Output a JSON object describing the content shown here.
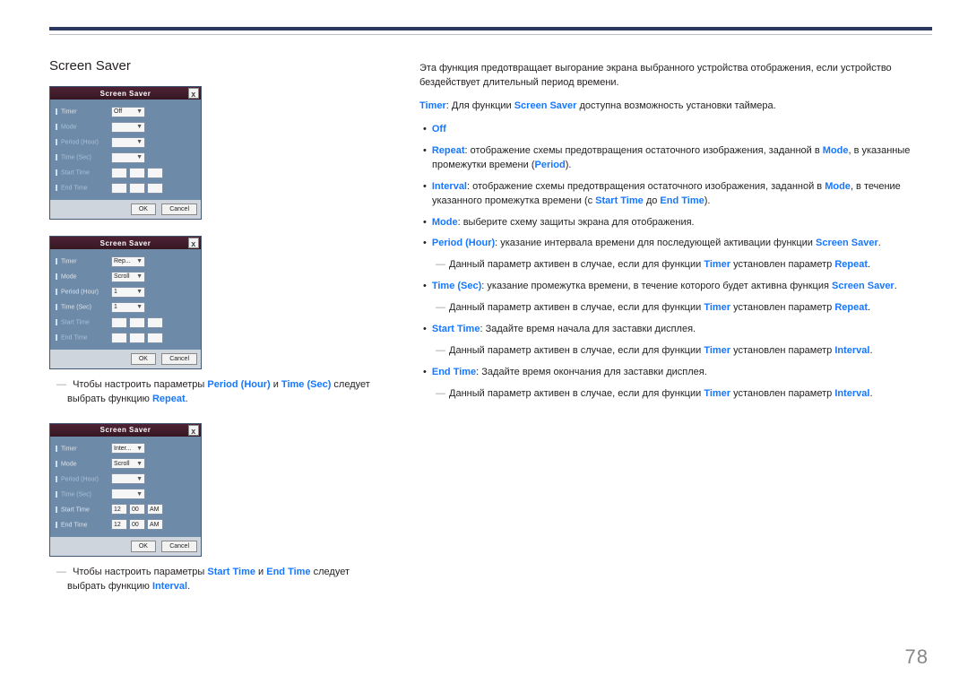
{
  "section_title": "Screen Saver",
  "page_number": "78",
  "dialog": {
    "title": "Screen Saver",
    "close": "x",
    "labels": {
      "timer": "Timer",
      "mode": "Mode",
      "period": "Period (Hour)",
      "timesec": "Time (Sec)",
      "start": "Start Time",
      "end": "End Time"
    },
    "values": {
      "off": "Off",
      "repeat": "Rep...",
      "interval": "Inter...",
      "scroll": "Scroll",
      "one": "1",
      "twelve": "12",
      "zero": "00",
      "am": "AM"
    },
    "ok": "OK",
    "cancel": "Cancel"
  },
  "caption1": {
    "pre": "Чтобы настроить параметры ",
    "kw1": "Period (Hour)",
    "mid1": " и ",
    "kw2": "Time (Sec)",
    "mid2": " следует выбрать функцию ",
    "kw3": "Repeat",
    "post": "."
  },
  "caption2": {
    "pre": "Чтобы настроить параметры ",
    "kw1": "Start Time",
    "mid1": " и ",
    "kw2": "End Time",
    "mid2": " следует выбрать функцию ",
    "kw3": "Interval",
    "post": "."
  },
  "right": {
    "intro": "Эта функция предотвращает выгорание экрана выбранного устройства отображения, если устройство бездействует длительный период времени.",
    "timer": {
      "kw": "Timer",
      "t1": ": Для функции ",
      "kw2": "Screen Saver",
      "t2": " доступна возможность установки таймера."
    },
    "off": "Off",
    "repeat": {
      "kw": "Repeat",
      "t1": ": отображение схемы предотвращения остаточного изображения, заданной в ",
      "kw2": "Mode",
      "t2": ", в указанные промежутки времени (",
      "kw3": "Period",
      "t3": ")."
    },
    "interval": {
      "kw": "Interval",
      "t1": ": отображение схемы предотвращения остаточного изображения, заданной в ",
      "kw2": "Mode",
      "t2": ", в течение указанного промежутка времени (с ",
      "kw3": "Start Time",
      "t3": " до ",
      "kw4": "End Time",
      "t4": ")."
    },
    "mode": {
      "kw": "Mode",
      "t1": ": выберите схему защиты экрана для отображения."
    },
    "periodh": {
      "kw": "Period (Hour)",
      "t1": ": указание интервала времени для последующей активации функции ",
      "kw2": "Screen Saver",
      "t2": "."
    },
    "periodh_note": {
      "t1": "Данный параметр активен в случае, если для функции ",
      "kw1": "Timer",
      "t2": " установлен параметр ",
      "kw2": "Repeat",
      "t3": "."
    },
    "timesec": {
      "kw": "Time (Sec)",
      "t1": ": указание промежутка времени, в течение которого будет активна функция ",
      "kw2": "Screen Saver",
      "t2": "."
    },
    "timesec_note": {
      "t1": "Данный параметр активен в случае, если для функции ",
      "kw1": "Timer",
      "t2": " установлен параметр ",
      "kw2": "Repeat",
      "t3": "."
    },
    "start": {
      "kw": "Start Time",
      "t1": ": Задайте время начала для заставки дисплея."
    },
    "start_note": {
      "t1": "Данный параметр активен в случае, если для функции ",
      "kw1": "Timer",
      "t2": " установлен параметр ",
      "kw2": "Interval",
      "t3": "."
    },
    "end": {
      "kw": "End Time",
      "t1": ": Задайте время окончания для заставки дисплея."
    },
    "end_note": {
      "t1": "Данный параметр активен в случае, если для функции ",
      "kw1": "Timer",
      "t2": " установлен параметр ",
      "kw2": "Interval",
      "t3": "."
    }
  }
}
